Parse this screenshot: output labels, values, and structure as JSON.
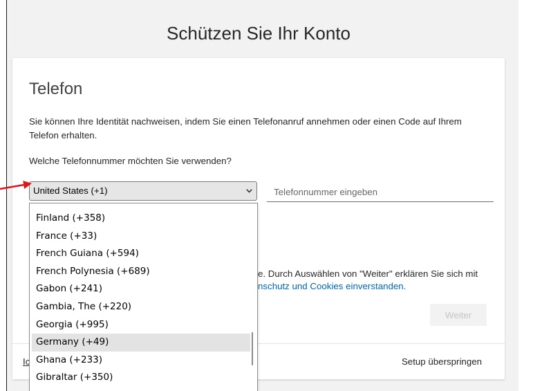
{
  "page": {
    "title": "Schützen Sie Ihr Konto"
  },
  "card": {
    "heading": "Telefon",
    "description": "Sie können Ihre Identität nachweisen, indem Sie einen Telefonanruf annehmen oder einen Code auf Ihrem\nTelefon erhalten.",
    "question": "Welche Telefonnummer möchten Sie verwenden?",
    "country_select": {
      "selected": "United States (+1)",
      "expanded": true,
      "options_visible": [
        "Finland (+358)",
        "France (+33)",
        "French Guiana (+594)",
        "French Polynesia (+689)",
        "Gabon (+241)",
        "Gambia, The (+220)",
        "Georgia (+995)",
        "Germany (+49)",
        "Ghana (+233)",
        "Gibraltar (+350)"
      ],
      "highlighted_index": 7
    },
    "phone_input": {
      "value": "",
      "placeholder": "Telefonnummer eingeben"
    },
    "consent_text": "e. Durch Auswählen von \"Weiter\" erklären Sie sich mit",
    "consent_link": "nschutz und Cookies einverstanden.",
    "next_button": {
      "label": "Weiter",
      "disabled": true
    }
  },
  "footer": {
    "alt_method_link": "Ic",
    "skip_link": "Setup überspringen"
  },
  "icons": {
    "select_chevron": "chevron-down-icon",
    "annotation": "red-arrow"
  },
  "colors": {
    "page_background": "#f2f2f2",
    "card_background": "#ffffff",
    "link": "#0067b8",
    "select_fill": "#e6e6e6",
    "highlighted_option": "#e3e3e3",
    "button_disabled_fill": "#f2f2f2",
    "button_disabled_text": "#c4c4c4",
    "annotation_arrow": "#e0161b"
  }
}
